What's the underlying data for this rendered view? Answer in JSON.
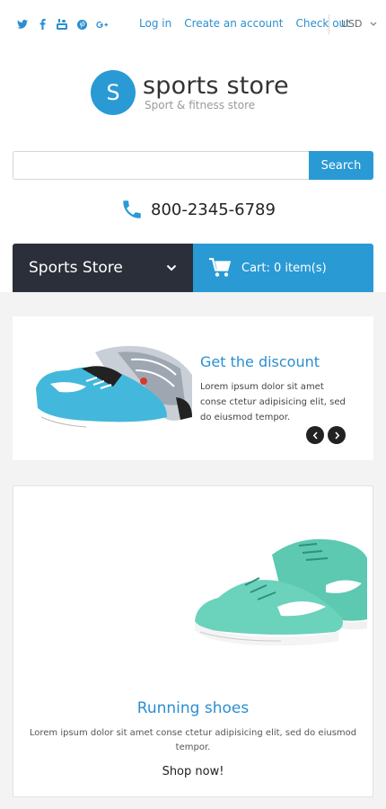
{
  "header": {
    "social_icons": [
      "twitter-icon",
      "facebook-icon",
      "youtube-icon",
      "pinterest-icon",
      "google-plus-icon"
    ],
    "links": [
      "Log in",
      "Create an account",
      "Check out"
    ],
    "currency": "USD"
  },
  "logo": {
    "letter": "S",
    "name": "sports store",
    "tagline": "Sport & fitness store",
    "color": "#2a9ad5"
  },
  "search": {
    "placeholder": "",
    "button": "Search"
  },
  "phone": {
    "number": "800-2345-6789",
    "icon": "phone-icon"
  },
  "nav": {
    "menu_label": "Sports Store",
    "cart_label": "Cart: 0 item(s)",
    "menu_color": "#2b2f3a",
    "cart_color": "#2a9ad5"
  },
  "slider": {
    "title": "Get the discount",
    "text": "Lorem ipsum dolor sit amet conse ctetur adipisicing elit, sed do eiusmod tempor.",
    "image": "blue-sneaker-image"
  },
  "product": {
    "title": "Running shoes",
    "text": "Lorem ipsum dolor sit amet conse ctetur adipisicing elit, sed do eiusmod tempor.",
    "link": "Shop now!",
    "image": "mint-sneaker-image"
  }
}
